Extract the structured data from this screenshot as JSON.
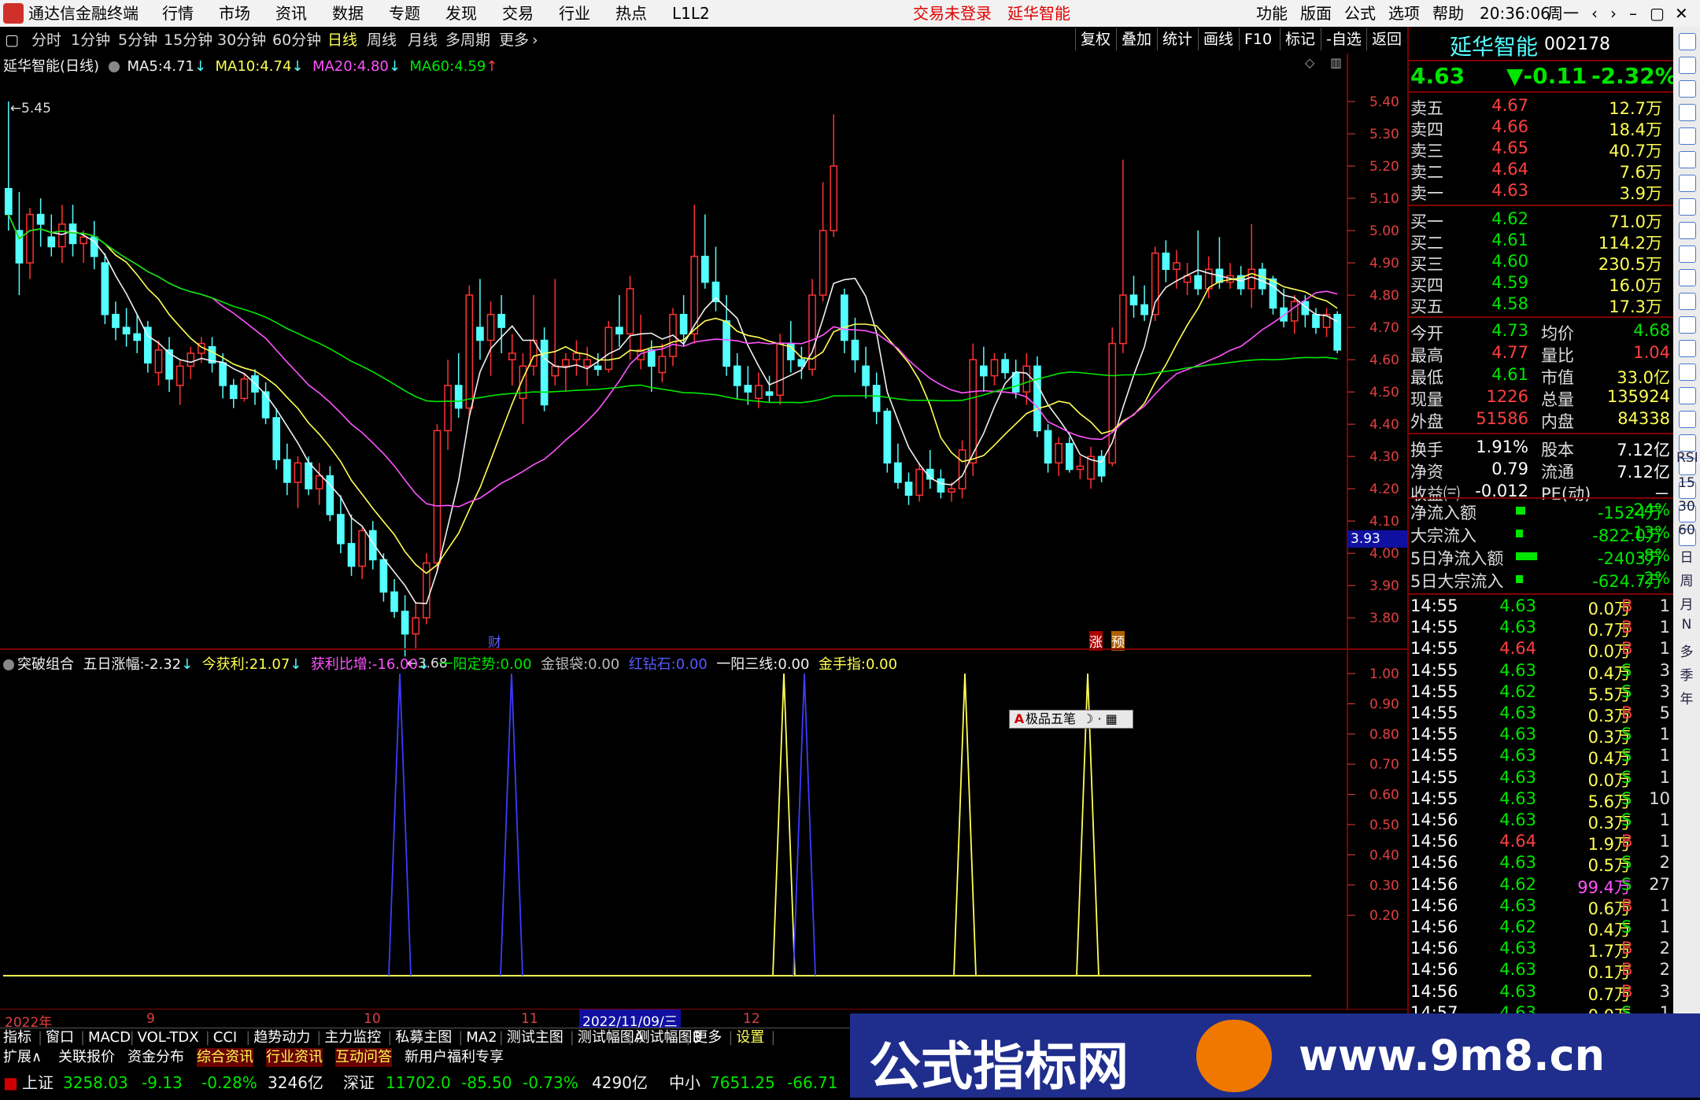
{
  "app": {
    "title": "通达信金融终端",
    "menu": [
      "行情",
      "市场",
      "资讯",
      "数据",
      "专题",
      "发现",
      "交易",
      "行业",
      "热点",
      "L1L2"
    ],
    "login_status": "交易未登录",
    "stock_name": "延华智能",
    "right_menu": [
      "功能",
      "版面",
      "公式",
      "选项",
      "帮助"
    ],
    "time": "20:36:06",
    "weekday": "周一"
  },
  "period_tabs": [
    "分时",
    "1分钟",
    "5分钟",
    "15分钟",
    "30分钟",
    "60分钟",
    "日线",
    "周线",
    "月线",
    "多周期",
    "更多"
  ],
  "chart_tools": [
    "复权",
    "叠加",
    "统计",
    "画线",
    "F10",
    "标记",
    "-自选",
    "返回"
  ],
  "main_chart": {
    "title": "延华智能(日线)",
    "ma": [
      {
        "label": "MA5:",
        "value": "4.71",
        "arrow": "↓",
        "color": "#f0f0f0"
      },
      {
        "label": "MA10:",
        "value": "4.74",
        "arrow": "↓",
        "color": "#ffff54"
      },
      {
        "label": "MA20:",
        "value": "4.80",
        "arrow": "↓",
        "color": "#ff54ff"
      },
      {
        "label": "MA60:",
        "value": "4.59",
        "arrow": "↑",
        "color": "#00e600"
      }
    ],
    "high_marker": "5.45",
    "low_marker": "3.68",
    "current_price_label": "3.93",
    "event_labels": [
      "财",
      "涨",
      "预"
    ]
  },
  "indicator": {
    "name": "突破组合",
    "items": [
      {
        "label": "五日涨幅:",
        "value": "-2.32",
        "arrow": "↓",
        "color": "#f0f0f0"
      },
      {
        "label": "今获利:",
        "value": "21.07",
        "arrow": "↓",
        "color": "#ffff54"
      },
      {
        "label": "获利比增:",
        "value": "-16.00",
        "arrow": "↓",
        "color": "#ff54ff"
      },
      {
        "label": "一阳定势:",
        "value": "0.00",
        "arrow": "",
        "color": "#00e600"
      },
      {
        "label": "金银袋:",
        "value": "0.00",
        "arrow": "",
        "color": "#bbbbbb"
      },
      {
        "label": "红钻石:",
        "value": "0.00",
        "arrow": "",
        "color": "#5858ff"
      },
      {
        "label": "一阳三线:",
        "value": "0.00",
        "arrow": "",
        "color": "#f0f0f0"
      },
      {
        "label": "金手指:",
        "value": "0.00",
        "arrow": "",
        "color": "#ffff54"
      }
    ],
    "input_widget": "极品五笔"
  },
  "x_axis": {
    "labels": [
      "2022年",
      "9",
      "10",
      "11",
      "12"
    ],
    "cursor_date": "2022/11/09/三"
  },
  "bottom_tabs": [
    "指标",
    "窗口",
    "MACD",
    "VOL-TDX",
    "CCI",
    "趋势动力",
    "主力监控",
    "私募主图",
    "MA2",
    "测试主图",
    "测试幅图A",
    "测试幅图B",
    "更多",
    "设置"
  ],
  "bottom_tabs2": [
    "扩展∧",
    "关联报价",
    "资金分布",
    "综合资讯",
    "行业资讯",
    "互动问答",
    "新用户福利专享"
  ],
  "status_bar": [
    {
      "name": "上证",
      "price": "3258.03",
      "change": "-9.13",
      "pct": "-0.28%",
      "amount": "3246亿"
    },
    {
      "name": "深证",
      "price": "11702.0",
      "change": "-85.50",
      "pct": "-0.73%",
      "amount": "4290亿"
    },
    {
      "name": "中小",
      "price": "7651.25",
      "change": "-66.71"
    }
  ],
  "quote": {
    "name": "延华智能",
    "code": "002178",
    "price": "4.63",
    "change": "▼-0.11",
    "pct": "-2.32%",
    "asks": [
      {
        "label": "卖五",
        "price": "4.67",
        "vol": "12.7万"
      },
      {
        "label": "卖四",
        "price": "4.66",
        "vol": "18.4万"
      },
      {
        "label": "卖三",
        "price": "4.65",
        "vol": "40.7万"
      },
      {
        "label": "卖二",
        "price": "4.64",
        "vol": "7.6万"
      },
      {
        "label": "卖一",
        "price": "4.63",
        "vol": "3.9万"
      }
    ],
    "bids": [
      {
        "label": "买一",
        "price": "4.62",
        "vol": "71.0万"
      },
      {
        "label": "买二",
        "price": "4.61",
        "vol": "114.2万"
      },
      {
        "label": "买三",
        "price": "4.60",
        "vol": "230.5万"
      },
      {
        "label": "买四",
        "price": "4.59",
        "vol": "16.0万"
      },
      {
        "label": "买五",
        "price": "4.58",
        "vol": "17.3万"
      }
    ],
    "stats": [
      {
        "l1": "今开",
        "v1": "4.73",
        "l2": "均价",
        "v2": "4.68"
      },
      {
        "l1": "最高",
        "v1": "4.77",
        "l2": "量比",
        "v2": "1.04"
      },
      {
        "l1": "最低",
        "v1": "4.61",
        "l2": "市值",
        "v2": "33.0亿"
      },
      {
        "l1": "现量",
        "v1": "1226",
        "l2": "总量",
        "v2": "135924"
      },
      {
        "l1": "外盘",
        "v1": "51586",
        "l2": "内盘",
        "v2": "84338"
      }
    ],
    "stats2": [
      {
        "l1": "换手",
        "v1": "1.91%",
        "l2": "股本",
        "v2": "7.12亿"
      },
      {
        "l1": "净资",
        "v1": "0.79",
        "l2": "流通",
        "v2": "7.12亿"
      },
      {
        "l1": "收益㈢",
        "v1": "-0.012",
        "l2": "PE(动)",
        "v2": "－"
      }
    ],
    "flows": [
      {
        "label": "净流入额",
        "value": "-1524万",
        "pct": "-24%",
        "bar": 0.24
      },
      {
        "label": "大宗流入",
        "value": "-822.0万",
        "pct": "-13%",
        "bar": 0.13
      },
      {
        "label": "5日净流入额",
        "value": "-2403万",
        "pct": "-8%",
        "bar": 0.8
      },
      {
        "label": "5日大宗流入",
        "value": "-624.7万",
        "pct": "-2%",
        "bar": 0.1
      }
    ],
    "ticks": [
      [
        "14:55",
        "4.63",
        "0.0万",
        "B",
        "1"
      ],
      [
        "14:55",
        "4.63",
        "0.7万",
        "B",
        "1"
      ],
      [
        "14:55",
        "4.64",
        "0.0万",
        "B",
        "1"
      ],
      [
        "14:55",
        "4.63",
        "0.4万",
        "S",
        "3"
      ],
      [
        "14:55",
        "4.62",
        "5.5万",
        "S",
        "3"
      ],
      [
        "14:55",
        "4.63",
        "0.3万",
        "B",
        "5"
      ],
      [
        "14:55",
        "4.63",
        "0.3万",
        "S",
        "1"
      ],
      [
        "14:55",
        "4.63",
        "0.4万",
        "S",
        "1"
      ],
      [
        "14:55",
        "4.63",
        "0.0万",
        "S",
        "1"
      ],
      [
        "14:55",
        "4.63",
        "5.6万",
        "S",
        "10"
      ],
      [
        "14:56",
        "4.63",
        "0.3万",
        "S",
        "1"
      ],
      [
        "14:56",
        "4.64",
        "1.9万",
        "B",
        "1"
      ],
      [
        "14:56",
        "4.63",
        "0.5万",
        "S",
        "2"
      ],
      [
        "14:56",
        "4.62",
        "99.4万",
        "S",
        "27"
      ],
      [
        "14:56",
        "4.63",
        "0.6万",
        "B",
        "1"
      ],
      [
        "14:56",
        "4.62",
        "0.4万",
        "S",
        "1"
      ],
      [
        "14:56",
        "4.63",
        "1.7万",
        "B",
        "2"
      ],
      [
        "14:56",
        "4.63",
        "0.1万",
        "B",
        "2"
      ],
      [
        "14:56",
        "4.63",
        "0.7万",
        "B",
        "3"
      ],
      [
        "14:57",
        "4.63",
        "0.0万",
        "S",
        "1"
      ]
    ]
  },
  "right_toolbar": [
    "RSI",
    "15",
    "30",
    "60",
    "日",
    "周",
    "月",
    "N",
    "多",
    "季",
    "年"
  ],
  "ad_banner": {
    "text": "公式指标网",
    "url": "www.9m8.cn"
  },
  "chart_data": {
    "type": "candlestick",
    "title": "延华智能(日线)",
    "y_ticks": [
      "5.40",
      "5.30",
      "5.20",
      "5.10",
      "5.00",
      "4.90",
      "4.80",
      "4.70",
      "4.60",
      "4.50",
      "4.40",
      "4.30",
      "4.20",
      "4.10",
      "4.00",
      "3.90",
      "3.80"
    ],
    "ylim": [
      3.72,
      5.5
    ],
    "ohlc": [
      [
        5.13,
        5.4,
        5.0,
        5.05
      ],
      [
        5.0,
        5.12,
        4.8,
        4.9
      ],
      [
        4.9,
        5.07,
        4.85,
        5.05
      ],
      [
        5.05,
        5.1,
        4.95,
        5.02
      ],
      [
        4.98,
        5.05,
        4.92,
        4.95
      ],
      [
        4.95,
        5.08,
        4.9,
        5.02
      ],
      [
        5.02,
        5.08,
        4.92,
        4.96
      ],
      [
        4.96,
        5.0,
        4.9,
        4.98
      ],
      [
        4.98,
        5.03,
        4.88,
        4.92
      ],
      [
        4.9,
        4.93,
        4.71,
        4.74
      ],
      [
        4.74,
        4.78,
        4.66,
        4.7
      ],
      [
        4.7,
        4.76,
        4.64,
        4.68
      ],
      [
        4.68,
        4.74,
        4.62,
        4.66
      ],
      [
        4.7,
        4.72,
        4.56,
        4.59
      ],
      [
        4.56,
        4.66,
        4.52,
        4.63
      ],
      [
        4.63,
        4.67,
        4.5,
        4.54
      ],
      [
        4.52,
        4.6,
        4.46,
        4.58
      ],
      [
        4.58,
        4.64,
        4.54,
        4.62
      ],
      [
        4.62,
        4.67,
        4.59,
        4.65
      ],
      [
        4.64,
        4.67,
        4.56,
        4.59
      ],
      [
        4.59,
        4.62,
        4.48,
        4.52
      ],
      [
        4.52,
        4.54,
        4.45,
        4.48
      ],
      [
        4.48,
        4.56,
        4.47,
        4.54
      ],
      [
        4.55,
        4.57,
        4.46,
        4.5
      ],
      [
        4.5,
        4.53,
        4.4,
        4.42
      ],
      [
        4.42,
        4.45,
        4.26,
        4.29
      ],
      [
        4.29,
        4.34,
        4.18,
        4.22
      ],
      [
        4.22,
        4.3,
        4.14,
        4.28
      ],
      [
        4.28,
        4.3,
        4.18,
        4.2
      ],
      [
        4.2,
        4.28,
        4.15,
        4.24
      ],
      [
        4.24,
        4.27,
        4.1,
        4.12
      ],
      [
        4.12,
        4.18,
        4.0,
        4.03
      ],
      [
        4.03,
        4.12,
        3.93,
        3.96
      ],
      [
        3.96,
        4.08,
        3.92,
        4.07
      ],
      [
        4.07,
        4.1,
        3.95,
        3.98
      ],
      [
        3.98,
        4.0,
        3.85,
        3.88
      ],
      [
        3.88,
        3.92,
        3.8,
        3.82
      ],
      [
        3.82,
        3.87,
        3.68,
        3.75
      ],
      [
        3.75,
        3.85,
        3.7,
        3.8
      ],
      [
        3.8,
        4.0,
        3.78,
        3.97
      ],
      [
        3.97,
        4.4,
        3.95,
        4.38
      ],
      [
        4.38,
        4.6,
        4.32,
        4.52
      ],
      [
        4.52,
        4.62,
        4.42,
        4.45
      ],
      [
        4.45,
        4.83,
        4.42,
        4.8
      ],
      [
        4.7,
        4.85,
        4.6,
        4.66
      ],
      [
        4.66,
        4.78,
        4.55,
        4.74
      ],
      [
        4.74,
        4.8,
        4.62,
        4.7
      ],
      [
        4.6,
        4.68,
        4.52,
        4.62
      ],
      [
        4.48,
        4.62,
        4.4,
        4.58
      ],
      [
        4.58,
        4.8,
        4.55,
        4.66
      ],
      [
        4.66,
        4.7,
        4.44,
        4.46
      ],
      [
        4.55,
        4.85,
        4.52,
        4.58
      ],
      [
        4.58,
        4.62,
        4.5,
        4.6
      ],
      [
        4.6,
        4.66,
        4.55,
        4.62
      ],
      [
        4.58,
        4.64,
        4.52,
        4.6
      ],
      [
        4.58,
        4.62,
        4.55,
        4.57
      ],
      [
        4.57,
        4.72,
        4.56,
        4.7
      ],
      [
        4.7,
        4.8,
        4.64,
        4.68
      ],
      [
        4.68,
        4.86,
        4.6,
        4.82
      ],
      [
        4.6,
        4.74,
        4.57,
        4.63
      ],
      [
        4.63,
        4.66,
        4.5,
        4.58
      ],
      [
        4.56,
        4.65,
        4.53,
        4.61
      ],
      [
        4.61,
        4.76,
        4.58,
        4.74
      ],
      [
        4.74,
        4.8,
        4.64,
        4.68
      ],
      [
        4.68,
        5.08,
        4.65,
        4.92
      ],
      [
        4.92,
        5.05,
        4.82,
        4.84
      ],
      [
        4.84,
        4.95,
        4.75,
        4.78
      ],
      [
        4.72,
        4.8,
        4.55,
        4.58
      ],
      [
        4.58,
        4.62,
        4.48,
        4.52
      ],
      [
        4.52,
        4.58,
        4.46,
        4.5
      ],
      [
        4.48,
        4.56,
        4.45,
        4.52
      ],
      [
        4.5,
        4.55,
        4.47,
        4.49
      ],
      [
        4.49,
        4.68,
        4.46,
        4.65
      ],
      [
        4.65,
        4.72,
        4.56,
        4.6
      ],
      [
        4.6,
        4.64,
        4.54,
        4.58
      ],
      [
        4.57,
        4.85,
        4.55,
        4.8
      ],
      [
        4.8,
        5.15,
        4.78,
        5.0
      ],
      [
        5.0,
        5.36,
        4.98,
        5.2
      ],
      [
        4.8,
        4.82,
        4.62,
        4.66
      ],
      [
        4.66,
        4.73,
        4.56,
        4.6
      ],
      [
        4.58,
        4.64,
        4.48,
        4.52
      ],
      [
        4.52,
        4.56,
        4.4,
        4.44
      ],
      [
        4.44,
        4.45,
        4.25,
        4.28
      ],
      [
        4.28,
        4.34,
        4.2,
        4.22
      ],
      [
        4.22,
        4.25,
        4.15,
        4.18
      ],
      [
        4.18,
        4.28,
        4.16,
        4.26
      ],
      [
        4.26,
        4.32,
        4.2,
        4.23
      ],
      [
        4.23,
        4.26,
        4.17,
        4.19
      ],
      [
        4.19,
        4.22,
        4.16,
        4.2
      ],
      [
        4.2,
        4.35,
        4.17,
        4.32
      ],
      [
        4.28,
        4.65,
        4.24,
        4.6
      ],
      [
        4.58,
        4.64,
        4.5,
        4.55
      ],
      [
        4.55,
        4.62,
        4.52,
        4.6
      ],
      [
        4.6,
        4.62,
        4.54,
        4.56
      ],
      [
        4.56,
        4.6,
        4.48,
        4.5
      ],
      [
        4.5,
        4.62,
        4.46,
        4.58
      ],
      [
        4.58,
        4.61,
        4.36,
        4.38
      ],
      [
        4.38,
        4.4,
        4.25,
        4.28
      ],
      [
        4.28,
        4.36,
        4.24,
        4.34
      ],
      [
        4.34,
        4.36,
        4.25,
        4.26
      ],
      [
        4.26,
        4.3,
        4.23,
        4.27
      ],
      [
        4.23,
        4.33,
        4.2,
        4.3
      ],
      [
        4.3,
        4.32,
        4.22,
        4.24
      ],
      [
        4.28,
        4.7,
        4.27,
        4.65
      ],
      [
        4.65,
        5.22,
        4.62,
        4.8
      ],
      [
        4.8,
        4.86,
        4.73,
        4.77
      ],
      [
        4.77,
        4.83,
        4.72,
        4.74
      ],
      [
        4.74,
        4.95,
        4.72,
        4.93
      ],
      [
        4.93,
        4.97,
        4.84,
        4.88
      ],
      [
        4.88,
        4.94,
        4.82,
        4.9
      ],
      [
        4.84,
        4.9,
        4.8,
        4.86
      ],
      [
        4.86,
        5.0,
        4.8,
        4.82
      ],
      [
        4.82,
        4.92,
        4.79,
        4.88
      ],
      [
        4.88,
        4.98,
        4.82,
        4.84
      ],
      [
        4.84,
        4.9,
        4.82,
        4.86
      ],
      [
        4.86,
        4.89,
        4.8,
        4.82
      ],
      [
        4.82,
        5.02,
        4.76,
        4.88
      ],
      [
        4.88,
        4.9,
        4.8,
        4.82
      ],
      [
        4.85,
        4.86,
        4.74,
        4.76
      ],
      [
        4.76,
        4.82,
        4.7,
        4.72
      ],
      [
        4.72,
        4.8,
        4.68,
        4.78
      ],
      [
        4.78,
        4.8,
        4.7,
        4.74
      ],
      [
        4.74,
        4.76,
        4.68,
        4.7
      ],
      [
        4.7,
        4.76,
        4.67,
        4.74
      ],
      [
        4.74,
        4.75,
        4.62,
        4.63
      ]
    ]
  }
}
